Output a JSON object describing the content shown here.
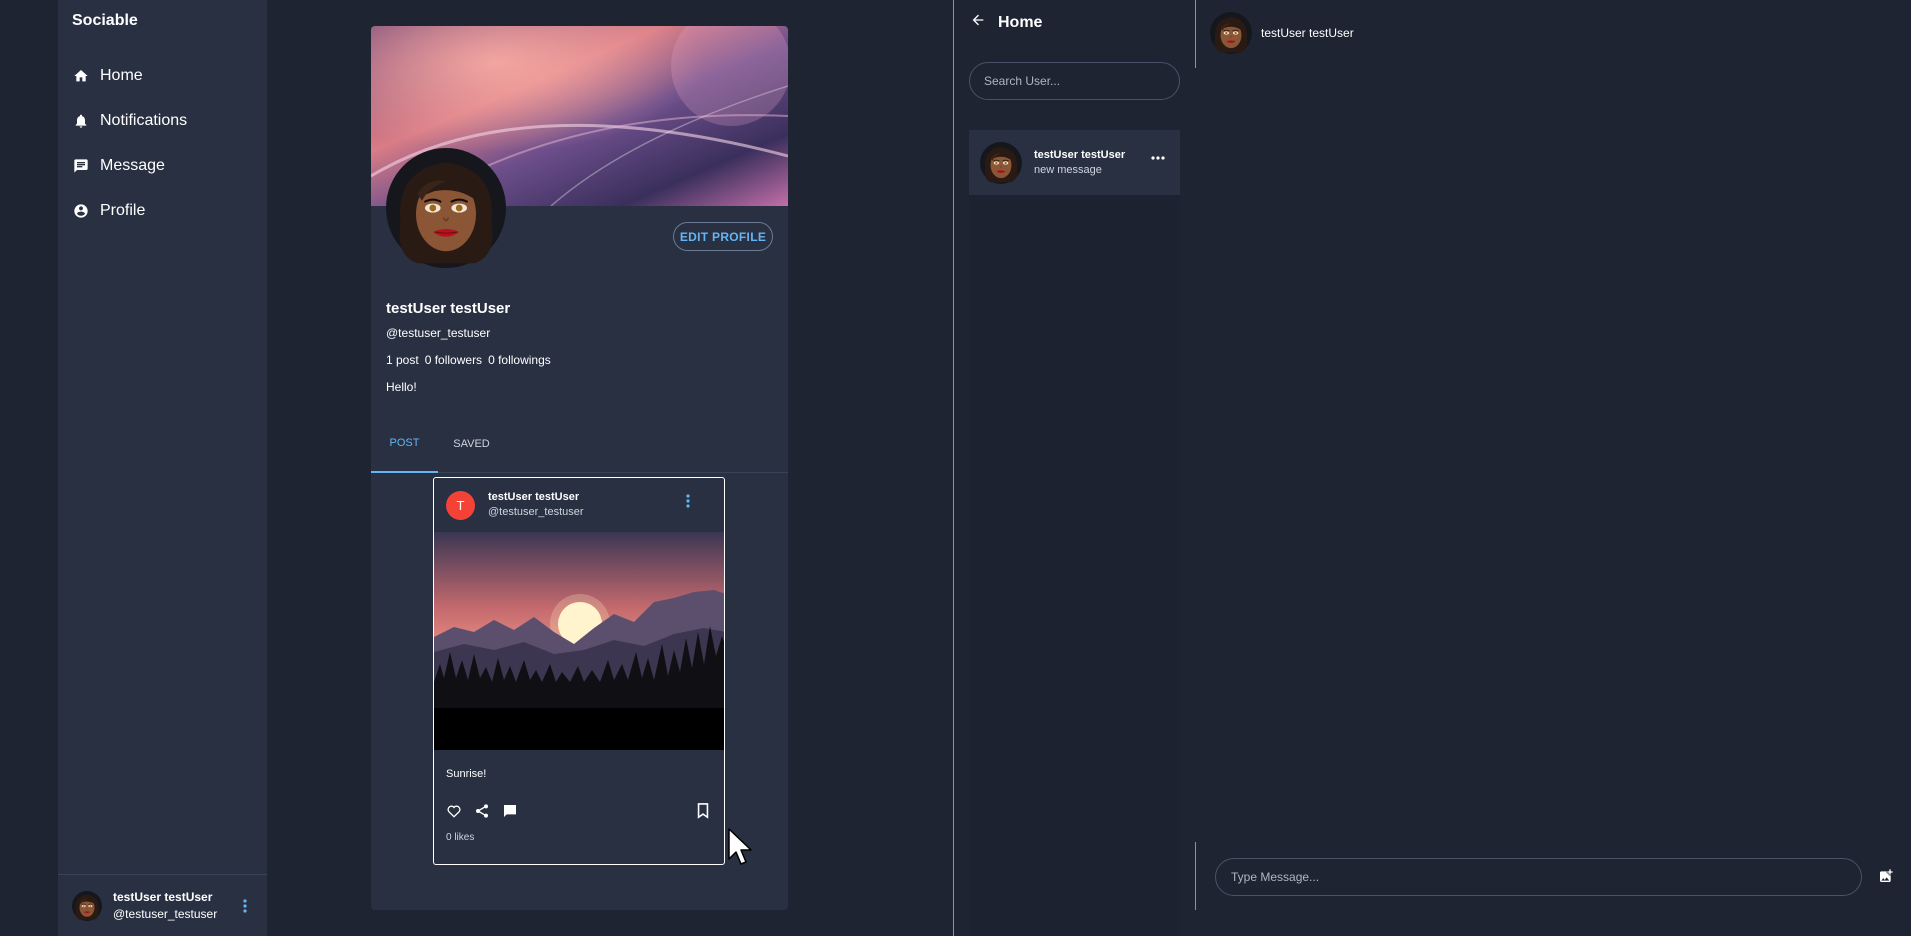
{
  "sidebar": {
    "brand": "Sociable",
    "items": [
      {
        "label": "Home",
        "icon": "home-icon"
      },
      {
        "label": "Notifications",
        "icon": "bell-icon"
      },
      {
        "label": "Message",
        "icon": "message-icon"
      },
      {
        "label": "Profile",
        "icon": "account-circle-icon"
      }
    ],
    "user": {
      "name": "testUser testUser",
      "handle": "@testuser_testuser"
    }
  },
  "profile": {
    "edit_label": "EDIT PROFILE",
    "name": "testUser testUser",
    "handle": "@testuser_testuser",
    "stats": {
      "posts": "1 post",
      "followers": "0 followers",
      "followings": "0 followings"
    },
    "bio": "Hello!",
    "tabs": [
      {
        "label": "POST",
        "active": true
      },
      {
        "label": "SAVED",
        "active": false
      }
    ]
  },
  "post": {
    "avatar_letter": "T",
    "name": "testUser testUser",
    "handle": "@testuser_testuser",
    "caption": "Sunrise!",
    "likes": "0 likes"
  },
  "messages": {
    "back_label": "Home",
    "search_placeholder": "Search User...",
    "conversations": [
      {
        "name": "testUser testUser",
        "preview": "new message"
      }
    ]
  },
  "chat": {
    "contact_name": "testUser testUser",
    "input_placeholder": "Type Message..."
  },
  "colors": {
    "background": "#1f2433",
    "panel": "#283042",
    "accent": "#64b5f6",
    "avatar_red": "#f44336"
  }
}
